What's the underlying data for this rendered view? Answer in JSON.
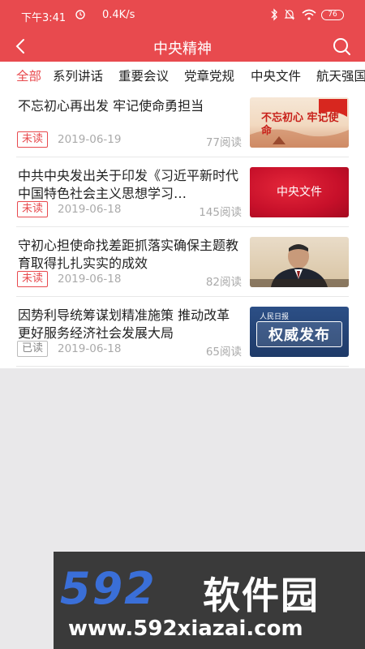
{
  "status": {
    "time": "下午3:41",
    "speed": "0.4K/s",
    "battery": "76"
  },
  "nav": {
    "title": "中央精神"
  },
  "tabs": [
    "全部",
    "系列讲话",
    "重要会议",
    "党章党规",
    "中央文件",
    "航天强国"
  ],
  "articles": [
    {
      "title": "不忘初心再出发 牢记使命勇担当",
      "status": "未读",
      "date": "2019-06-19",
      "views": "77阅读",
      "thumb_text": "不忘初心 牢记使命"
    },
    {
      "title": "中共中央发出关于印发《习近平新时代中国特色社会主义思想学习…",
      "status": "未读",
      "date": "2019-06-18",
      "views": "145阅读",
      "thumb_text": "中央文件"
    },
    {
      "title": "守初心担使命找差距抓落实确保主题教育取得扎扎实实的成效",
      "status": "未读",
      "date": "2019-06-18",
      "views": "82阅读",
      "thumb_text": ""
    },
    {
      "title": "因势利导统筹谋划精准施策 推动改革更好服务经济社会发展大局",
      "status": "已读",
      "date": "2019-06-18",
      "views": "65阅读",
      "thumb_text": "权威发布",
      "thumb_logo": "人民日报"
    }
  ],
  "watermark": {
    "logo": "592",
    "name": "软件园",
    "url": "www.592xiazai.com"
  },
  "colors": {
    "accent": "#e84a4e",
    "unread": "#e84a4e",
    "read": "#888888"
  }
}
